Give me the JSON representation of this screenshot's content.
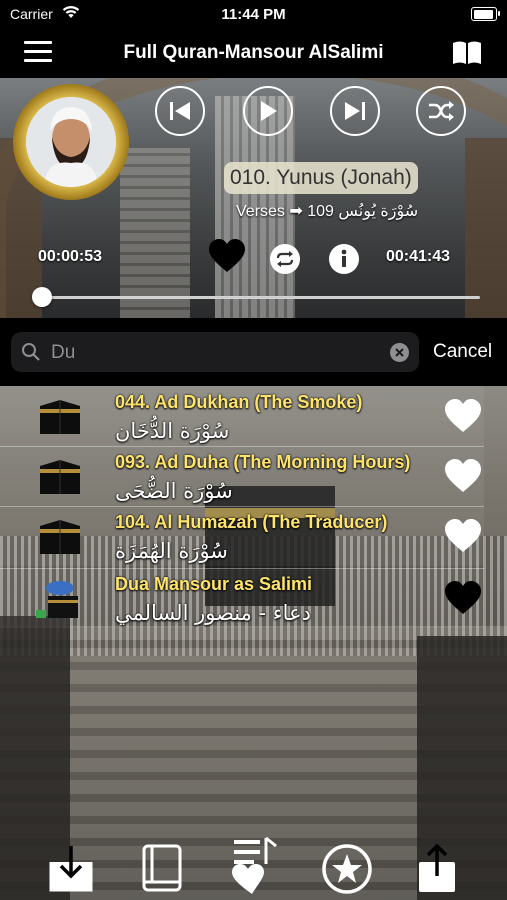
{
  "status": {
    "carrier": "Carrier",
    "time": "11:44 PM"
  },
  "nav": {
    "title": "Full Quran-Mansour AlSalimi"
  },
  "player": {
    "surah_title": "010. Yunus (Jonah)",
    "verses_label": "Verses",
    "verses_count": "109",
    "surah_arabic": "سُوْرَة يُونُس",
    "elapsed": "00:00:53",
    "total": "00:41:43",
    "progress": 0.01,
    "favorited": true
  },
  "search": {
    "query": "Du",
    "placeholder": "Search",
    "cancel_label": "Cancel"
  },
  "results": [
    {
      "title": "044. Ad Dukhan (The Smoke)",
      "arabic": "سُوْرَة الدُّخَان",
      "favorite": false,
      "thumb": "kaaba-icon"
    },
    {
      "title": "093. Ad Duha (The Morning Hours)",
      "arabic": "سُوْرَة الضُّحَى",
      "favorite": false,
      "thumb": "kaaba-icon"
    },
    {
      "title": "104. Al Humazah (The Traducer)",
      "arabic": "سُوْرَة الهُمَزَة",
      "favorite": false,
      "thumb": "kaaba-icon"
    },
    {
      "title": "Dua Mansour as Salimi",
      "arabic": "دعاء - منصور السالمي",
      "favorite": true,
      "thumb": "dua-icon"
    }
  ],
  "tabs": [
    {
      "icon": "download-icon"
    },
    {
      "icon": "book-icon"
    },
    {
      "icon": "favorites-list-icon"
    },
    {
      "icon": "star-icon"
    },
    {
      "icon": "share-icon"
    }
  ],
  "colors": {
    "title_yellow": "#ffe46b",
    "gold_ring": "#d9b84a",
    "search_field": "#1c1c1e"
  }
}
